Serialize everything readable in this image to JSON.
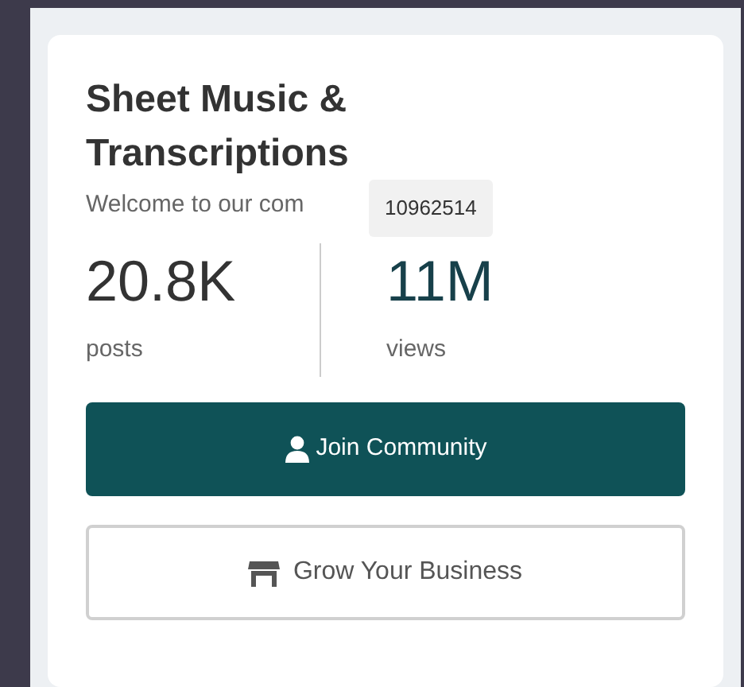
{
  "title": "Sheet Music & Transcriptions",
  "subtitle": "Welcome to our com",
  "tooltip": "10962514",
  "stats": [
    {
      "value": "20.8K",
      "label": "posts"
    },
    {
      "value": "11M",
      "label": "views"
    }
  ],
  "buttons": [
    {
      "label": "Join Community",
      "kind": "primary"
    },
    {
      "label": "Grow Your Business",
      "kind": "outline"
    }
  ]
}
